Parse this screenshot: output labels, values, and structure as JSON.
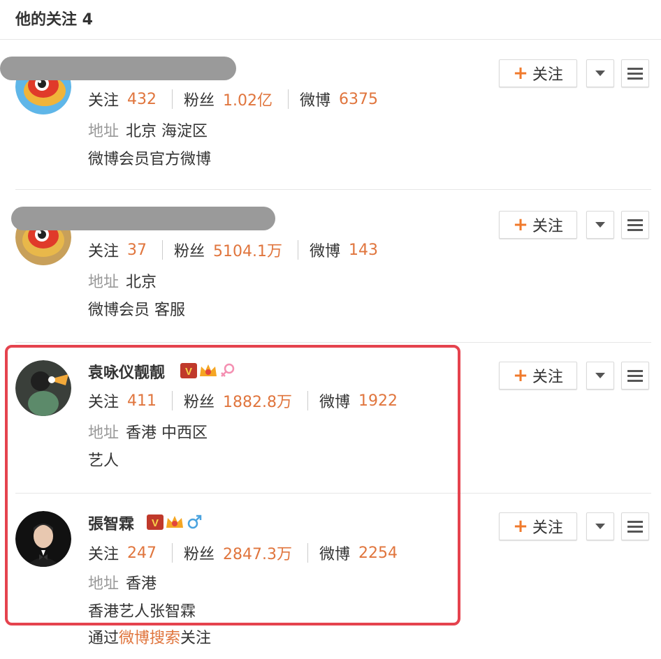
{
  "header": {
    "title": "他的关注 4"
  },
  "labels": {
    "following": "关注",
    "fans": "粉丝",
    "weibo": "微博",
    "address": "地址",
    "follow_button": "关注"
  },
  "users": [
    {
      "name": "",
      "name_hidden": true,
      "following": "432",
      "fans": "1.02亿",
      "weibo": "6375",
      "address": "北京 海淀区",
      "description": "微博会员官方微博"
    },
    {
      "name": "",
      "name_hidden": true,
      "following": "37",
      "fans": "5104.1万",
      "weibo": "143",
      "address": "北京",
      "description": "微博会员 客服"
    },
    {
      "name": "袁咏仪靓靓",
      "badges": [
        "verified-v-icon",
        "vip-crown-icon",
        "female-icon"
      ],
      "following": "411",
      "fans": "1882.8万",
      "weibo": "1922",
      "address": "香港 中西区",
      "description": "艺人"
    },
    {
      "name": "張智霖",
      "badges": [
        "verified-v-icon",
        "vip-crown-icon",
        "male-icon"
      ],
      "following": "247",
      "fans": "2847.3万",
      "weibo": "2254",
      "address": "香港",
      "description": "香港艺人张智霖",
      "via_prefix": "通过",
      "via_link": "微博搜索",
      "via_suffix": "关注"
    }
  ],
  "colors": {
    "accent": "#e0753d",
    "highlight": "#e5434e",
    "muted": "#999999",
    "text": "#333333"
  }
}
